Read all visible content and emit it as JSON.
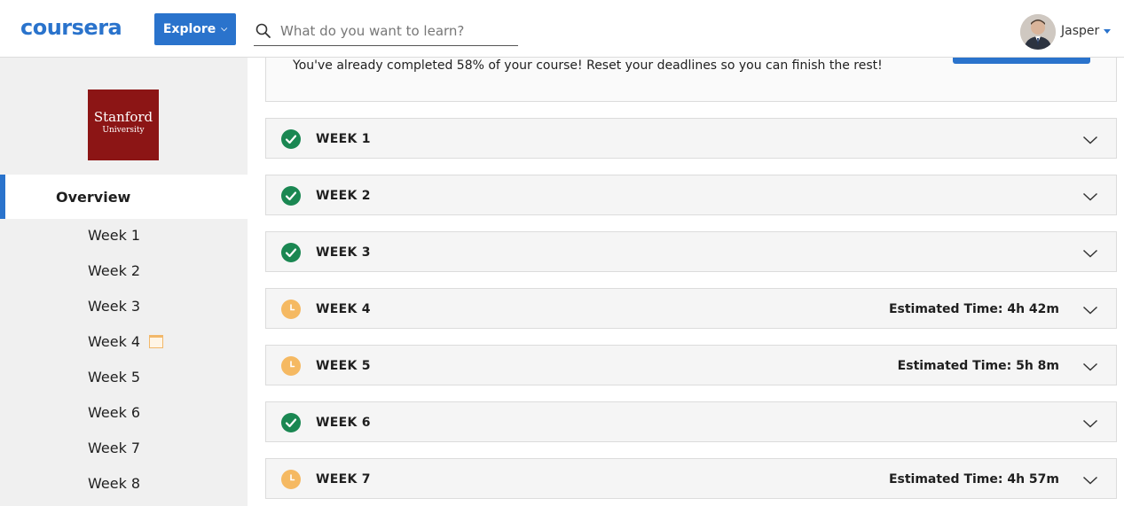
{
  "header": {
    "logo": "coursera",
    "explore_label": "Explore",
    "explore_icon": "chevron-down-icon",
    "search_placeholder": "What do you want to learn?",
    "search_value": "",
    "username": "Jasper"
  },
  "sidebar": {
    "university_line1": "Stanford",
    "university_line2": "University",
    "overview_label": "Overview",
    "weeks": [
      {
        "label": "Week 1",
        "icon": ""
      },
      {
        "label": "Week 2",
        "icon": ""
      },
      {
        "label": "Week 3",
        "icon": ""
      },
      {
        "label": "Week 4",
        "icon": "calendar-icon"
      },
      {
        "label": "Week 5",
        "icon": ""
      },
      {
        "label": "Week 6",
        "icon": ""
      },
      {
        "label": "Week 7",
        "icon": ""
      },
      {
        "label": "Week 8",
        "icon": ""
      }
    ]
  },
  "main": {
    "banner_text": "You've already completed 58% of your course! Reset your deadlines so you can finish the rest!",
    "completed_percent": 58,
    "weeks": [
      {
        "label": "WEEK 1",
        "status": "completed",
        "estimated_time": ""
      },
      {
        "label": "WEEK 2",
        "status": "completed",
        "estimated_time": ""
      },
      {
        "label": "WEEK 3",
        "status": "completed",
        "estimated_time": ""
      },
      {
        "label": "WEEK 4",
        "status": "in-progress",
        "estimated_time": "Estimated Time: 4h 42m"
      },
      {
        "label": "WEEK 5",
        "status": "in-progress",
        "estimated_time": "Estimated Time: 5h 8m"
      },
      {
        "label": "WEEK 6",
        "status": "completed",
        "estimated_time": ""
      },
      {
        "label": "WEEK 7",
        "status": "in-progress",
        "estimated_time": "Estimated Time: 4h 57m"
      }
    ]
  },
  "colors": {
    "brand": "#2a73cc",
    "completed": "#1a8752",
    "pending": "#f5b962",
    "stanford": "#8c1515"
  }
}
